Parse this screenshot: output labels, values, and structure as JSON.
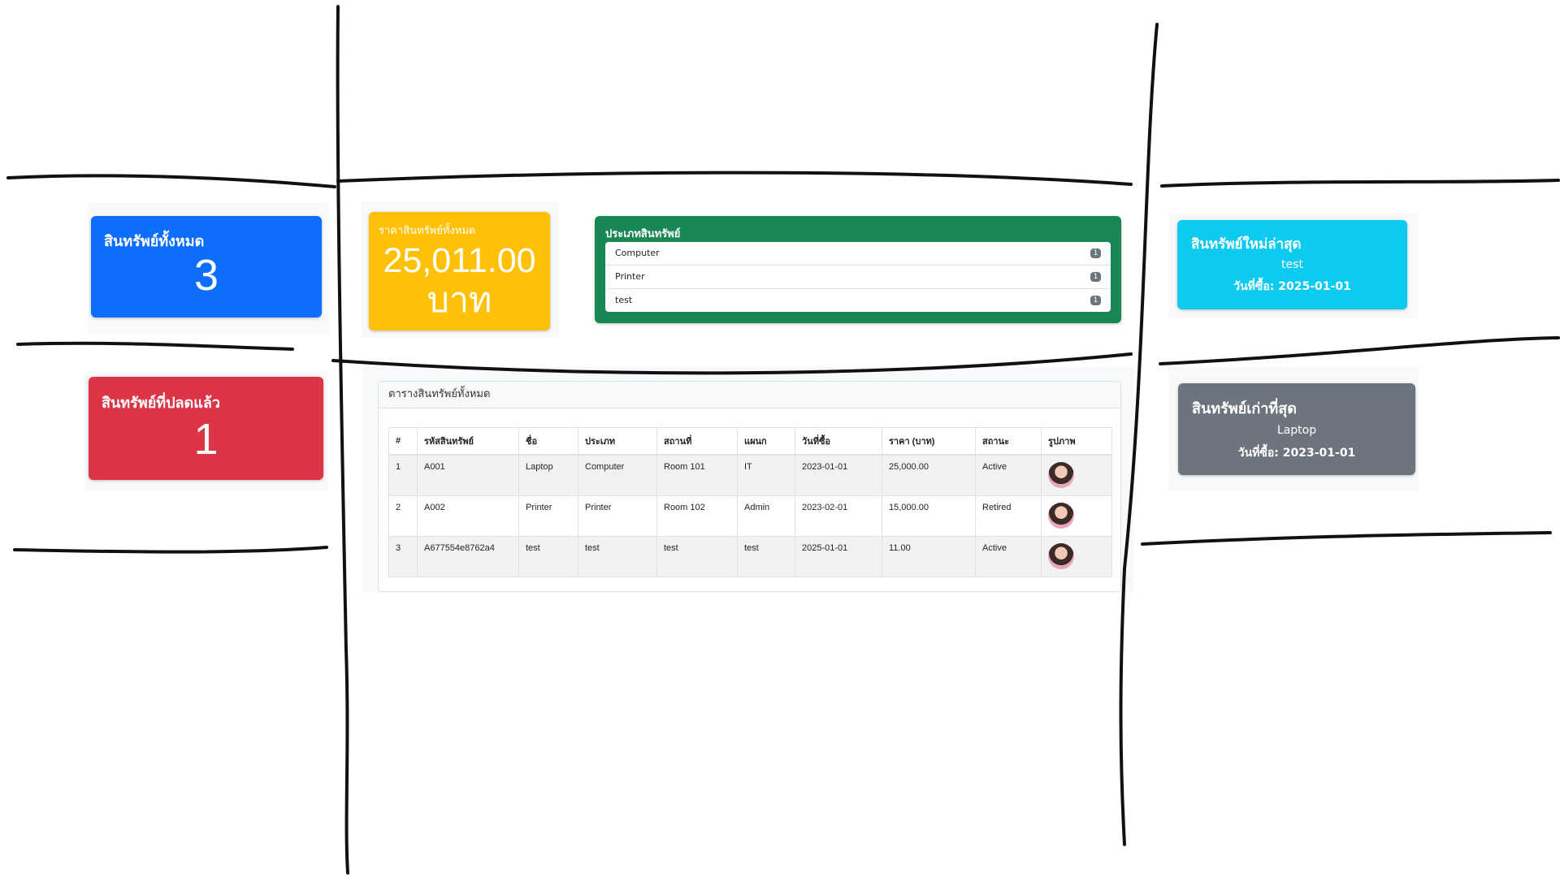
{
  "cards": {
    "total_assets": {
      "title": "สินทรัพย์ทั้งหมด",
      "value": "3",
      "color": "#0d6efd"
    },
    "disposed_assets": {
      "title": "สินทรัพย์ที่ปลดแล้ว",
      "value": "1",
      "color": "#dc3545"
    },
    "total_value": {
      "title": "ราคาสินทรัพย์ทั้งหมด",
      "amount": "25,011.00",
      "unit": "บาท",
      "color": "#ffc107"
    },
    "asset_types": {
      "title": "ประเภทสินทรัพย์",
      "color": "#198754",
      "items": [
        {
          "label": "Computer",
          "count": "1"
        },
        {
          "label": "Printer",
          "count": "1"
        },
        {
          "label": "test",
          "count": "1"
        }
      ]
    },
    "newest_asset": {
      "title": "สินทรัพย์ใหม่ล่าสุด",
      "name": "test",
      "date_line": "วันที่ซื้อ: 2025-01-01",
      "color": "#0dcaf0"
    },
    "oldest_asset": {
      "title": "สินทรัพย์เก่าที่สุด",
      "name": "Laptop",
      "date_line": "วันที่ซื้อ: 2023-01-01",
      "color": "#6c757d"
    }
  },
  "asset_table": {
    "title": "ตารางสินทรัพย์ทั้งหมด",
    "columns": [
      "#",
      "รหัสสินทรัพย์",
      "ชื่อ",
      "ประเภท",
      "สถานที่",
      "แผนก",
      "วันที่ซื้อ",
      "ราคา (บาท)",
      "สถานะ",
      "รูปภาพ"
    ],
    "rows": [
      [
        "1",
        "A001",
        "Laptop",
        "Computer",
        "Room 101",
        "IT",
        "2023-01-01",
        "25,000.00",
        "Active"
      ],
      [
        "2",
        "A002",
        "Printer",
        "Printer",
        "Room 102",
        "Admin",
        "2023-02-01",
        "15,000.00",
        "Retired"
      ],
      [
        "3",
        "A677554e8762a4",
        "test",
        "test",
        "test",
        "test",
        "2025-01-01",
        "11.00",
        "Active"
      ]
    ],
    "image_icon": "avatar-photo"
  }
}
